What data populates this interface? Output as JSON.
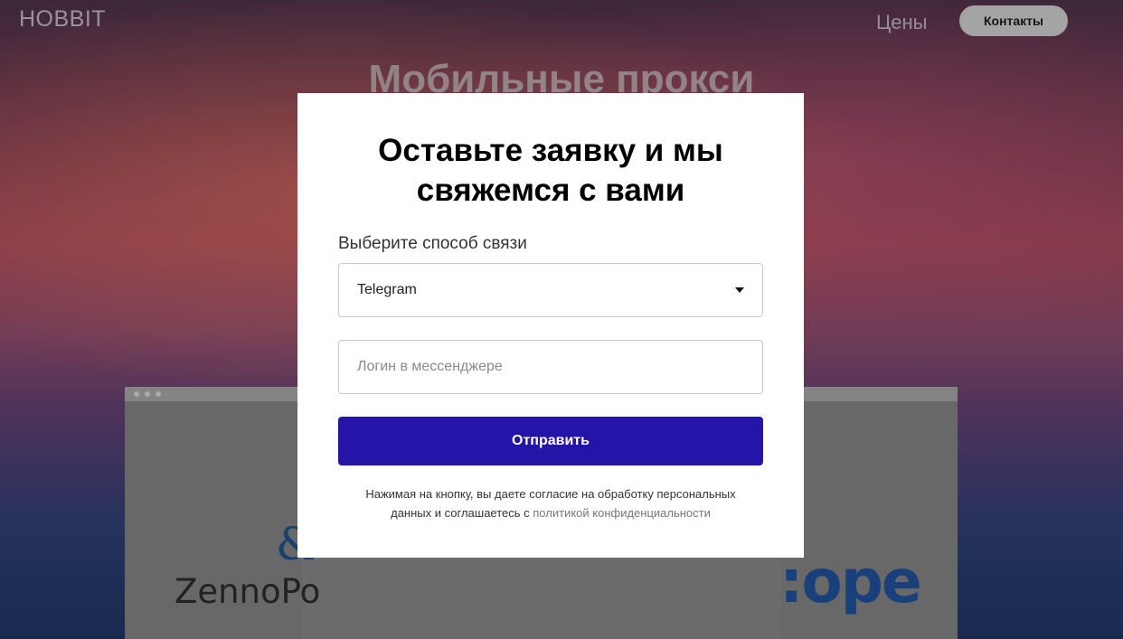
{
  "header": {
    "logo": "HOBBIT",
    "nav_prices": "Цены",
    "nav_contacts": "Контакты"
  },
  "hero": {
    "title": "Мобильные прокси"
  },
  "background_logos": {
    "zenno_text": "ZennoPo",
    "scope_text": ":ope"
  },
  "modal": {
    "title_line1": "Оставьте заявку и мы",
    "title_line2": "свяжемся с вами",
    "contact_method_label": "Выберите способ связи",
    "contact_method_value": "Telegram",
    "login_placeholder": "Логин в мессенджере",
    "login_value": "",
    "submit_label": "Отправить",
    "consent_text_line1": "Нажимая на кнопку, вы даете согласие на обработку персональных",
    "consent_text_line2": "данных и соглашаетесь с ",
    "privacy_link": "политикой конфиденциальности"
  },
  "colors": {
    "primary_button": "#2414a8",
    "modal_bg": "#ffffff",
    "contacts_pill": "#c8c8c8"
  },
  "icons": {
    "select_caret": "caret-down-icon"
  }
}
